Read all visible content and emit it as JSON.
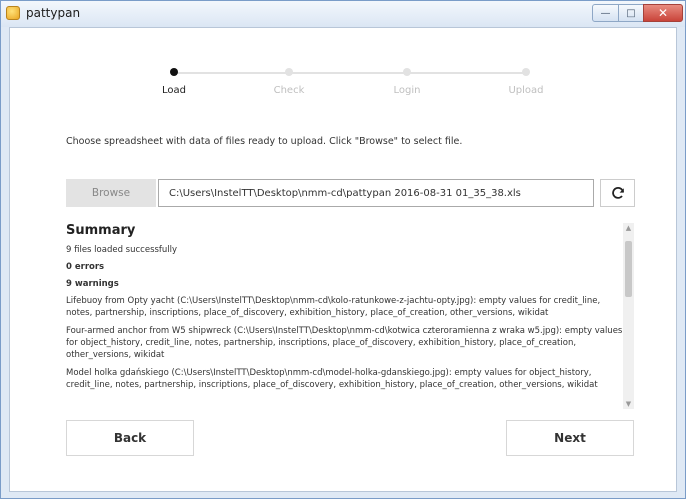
{
  "window": {
    "title": "pattypan",
    "minimize_label": "—",
    "maximize_label": "□",
    "close_label": "✕"
  },
  "steps": [
    {
      "label": "Load",
      "active": true
    },
    {
      "label": "Check",
      "active": false
    },
    {
      "label": "Login",
      "active": false
    },
    {
      "label": "Upload",
      "active": false
    }
  ],
  "instructions": "Choose spreadsheet with data of files ready to upload. Click \"Browse\" to select file.",
  "file": {
    "browse_label": "Browse",
    "path": "C:\\Users\\InstelTT\\Desktop\\nmm-cd\\pattypan 2016-08-31 01_35_38.xls",
    "refresh_icon": "refresh-icon"
  },
  "summary": {
    "title": "Summary",
    "loaded": "9 files loaded successfully",
    "errors": "0 errors",
    "warnings_count": "9 warnings",
    "warnings": [
      "Lifebuoy from Opty yacht (C:\\Users\\InstelTT\\Desktop\\nmm-cd\\kolo-ratunkowe-z-jachtu-opty.jpg): empty values for credit_line, notes, partnership, inscriptions, place_of_discovery, exhibition_history, place_of_creation, other_versions, wikidat",
      "Four-armed anchor from W5 shipwreck (C:\\Users\\InstelTT\\Desktop\\nmm-cd\\kotwica czteroramienna z wraka w5.jpg): empty values for object_history, credit_line, notes, partnership, inscriptions, place_of_discovery, exhibition_history, place_of_creation, other_versions, wikidat",
      "Model holka gdańskiego (C:\\Users\\InstelTT\\Desktop\\nmm-cd\\model-holka-gdanskiego.jpg): empty values for object_history, credit_line, notes, partnership, inscriptions, place_of_discovery, exhibition_history, place_of_creation, other_versions, wikidat"
    ]
  },
  "nav": {
    "back_label": "Back",
    "next_label": "Next"
  }
}
